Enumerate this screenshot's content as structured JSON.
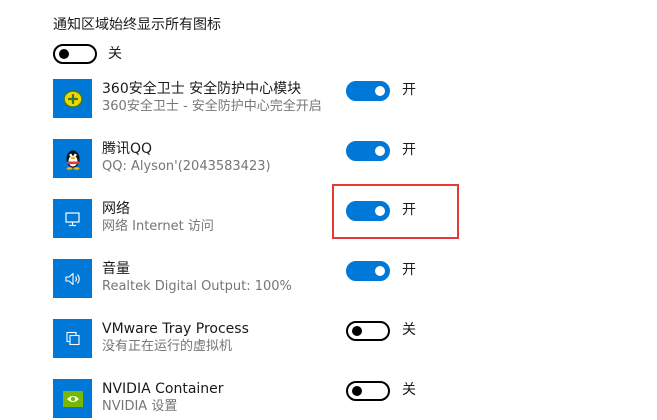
{
  "header": {
    "title": "通知区域始终显示所有图标",
    "master_toggle": {
      "state": "off",
      "label": "关"
    }
  },
  "apps": [
    {
      "name": "360安全卫士 安全防护中心模块",
      "status": "360安全卫士 - 安全防护中心完全开启",
      "icon": "360-safe-guard-icon",
      "toggle_state": "on",
      "toggle_label": "开"
    },
    {
      "name": "腾讯QQ",
      "status": "QQ: Alyson'(2043583423)",
      "icon": "qq-penguin-icon",
      "toggle_state": "on",
      "toggle_label": "开"
    },
    {
      "name": "网络",
      "status": "网络 Internet 访问",
      "icon": "network-monitor-icon",
      "toggle_state": "on",
      "toggle_label": "开"
    },
    {
      "name": "音量",
      "status": "Realtek Digital Output: 100%",
      "icon": "speaker-volume-icon",
      "toggle_state": "on",
      "toggle_label": "开"
    },
    {
      "name": "VMware Tray Process",
      "status": "没有正在运行的虚拟机",
      "icon": "vmware-tray-icon",
      "toggle_state": "off",
      "toggle_label": "关"
    },
    {
      "name": "NVIDIA Container",
      "status": "NVIDIA 设置",
      "icon": "nvidia-logo-icon",
      "toggle_state": "off",
      "toggle_label": "关"
    }
  ],
  "colors": {
    "accent": "#0078d7",
    "highlight": "#e53935",
    "secondary_text": "#767676",
    "nvidia_green": "#76b900"
  }
}
